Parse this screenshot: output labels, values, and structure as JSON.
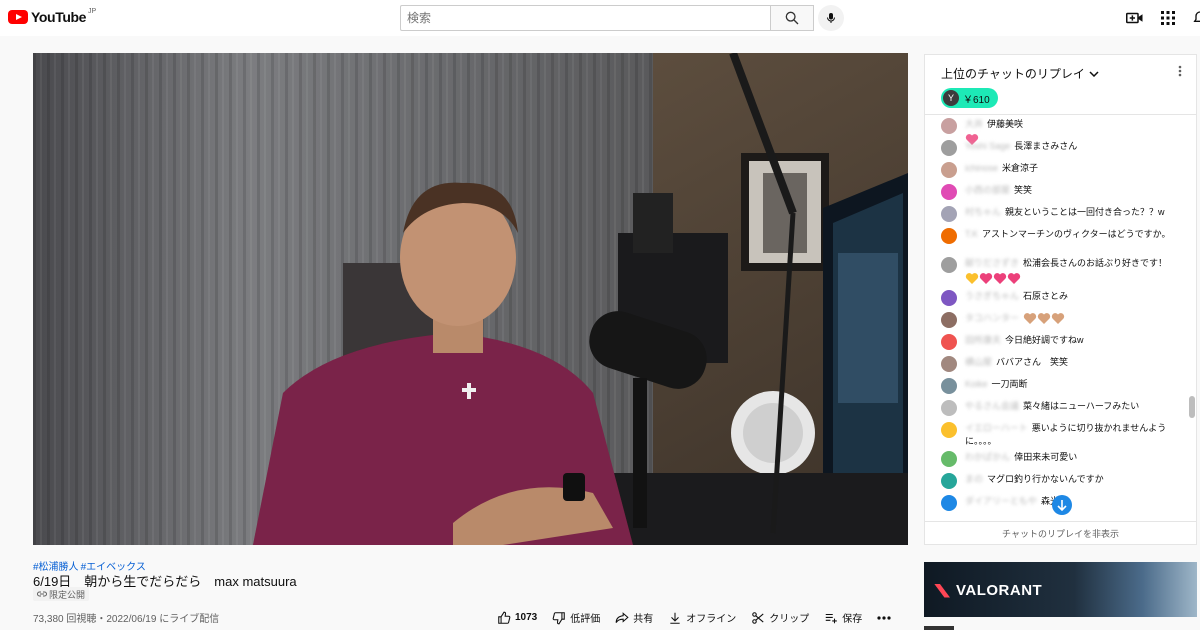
{
  "header": {
    "logo_text": "YouTube",
    "logo_region": "JP",
    "search_placeholder": "検索"
  },
  "video": {
    "hashtags": [
      "#松浦勝人",
      "#エイベックス"
    ],
    "title": "6/19日　朝から生でだらだら　max matsuura",
    "privacy_badge": "限定公開",
    "stats": "73,380 回視聴・2022/06/19 にライブ配信",
    "actions": {
      "like_count": "1073",
      "dislike_label": "低評価",
      "share_label": "共有",
      "offline_label": "オフライン",
      "clip_label": "クリップ",
      "save_label": "保存"
    }
  },
  "chat": {
    "title": "上位のチャットのリプレイ",
    "superchat_initial": "Y",
    "superchat_amount": "￥610",
    "hide_replay_label": "チャットのリプレイを非表示",
    "messages": [
      {
        "author": "大井",
        "text": "伊藤美咲",
        "color": "#c8a0a0",
        "emoji": [
          "#f06292"
        ]
      },
      {
        "author": "Yoshi Sage",
        "text": "長澤まさみさん",
        "color": "#9e9e9e",
        "emoji": []
      },
      {
        "author": "ichinose",
        "text": "米倉涼子",
        "color": "#c99f8f",
        "emoji": []
      },
      {
        "author": "小西の部屋",
        "text": "笑笑",
        "color": "#e04bb4",
        "emoji": []
      },
      {
        "author": "村ちゃん",
        "text": "親友ということは一回付き合った？？w",
        "color": "#a3a3b5",
        "emoji": []
      },
      {
        "author": "T.K",
        "text": "アストンマーチンのヴィクターはどうですか。",
        "color": "#ef6c00",
        "emoji": []
      },
      {
        "author": "献りださずき",
        "text": "松浦会長さんのお話ぶり好きです！",
        "color": "#9e9e9e",
        "emoji": [
          "#fbc02d",
          "#ec407a",
          "#ec407a",
          "#ec407a"
        ]
      },
      {
        "author": "うさぎちゃん",
        "text": "石原さとみ",
        "color": "#7e57c2",
        "emoji": []
      },
      {
        "author": "タコハンター",
        "text": "",
        "color": "#8d6e63",
        "emoji": [
          "#d7a17a",
          "#d7a17a",
          "#d7a17a"
        ]
      },
      {
        "author": "田所康夫",
        "text": "今日絶好調ですねw",
        "color": "#ef5350",
        "emoji": []
      },
      {
        "author": "横山屋",
        "text": "ババアさん　笑笑",
        "color": "#a1887f",
        "emoji": []
      },
      {
        "author": "Koike",
        "text": "一刀両断",
        "color": "#78909c",
        "emoji": []
      },
      {
        "author": "やるさん会議",
        "text": "菜々緒はニューハーフみたい",
        "color": "#bdbdbd",
        "emoji": []
      },
      {
        "author": "イエローハート",
        "text": "悪いように切り抜かれませんように。。。。",
        "color": "#fbc02d",
        "emoji": []
      },
      {
        "author": "わかぱかん",
        "text": "倖田来未可愛い",
        "color": "#66bb6a",
        "emoji": []
      },
      {
        "author": "まの",
        "text": "マグロ釣り行かないんですか",
        "color": "#26a69a",
        "emoji": []
      },
      {
        "author": "ダイアリーともや",
        "text": "森光",
        "color": "#1e88e5",
        "emoji": []
      }
    ]
  },
  "ad": {
    "brand": "VALORANT",
    "accent_color": "#ff4655"
  },
  "colors": {
    "youtube_red": "#ff0000",
    "link_blue": "#065fd4",
    "superchat_teal": "#1de9b6"
  }
}
